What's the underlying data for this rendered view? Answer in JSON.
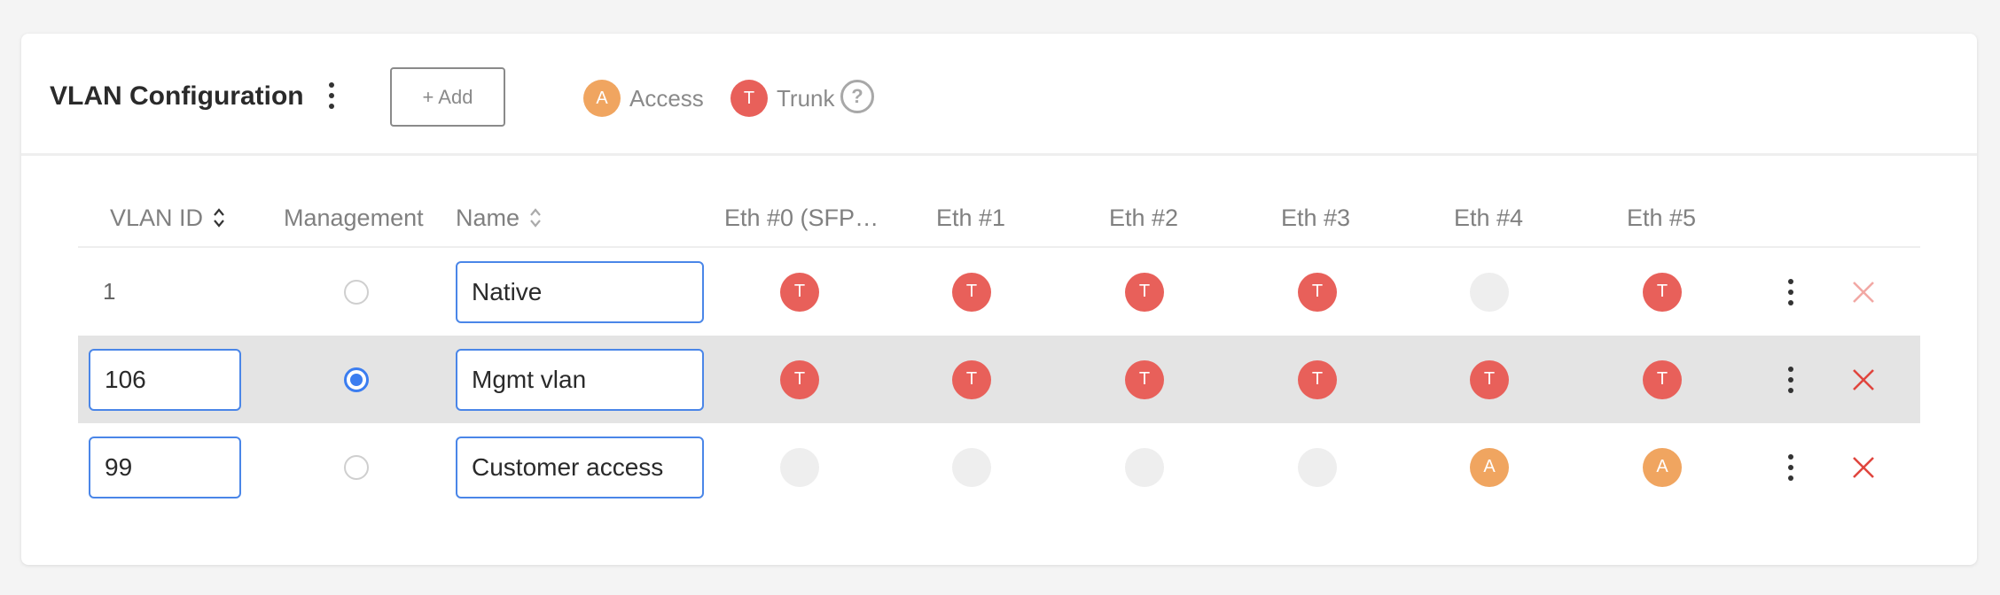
{
  "header": {
    "title": "VLAN Configuration",
    "add_label": "+ Add",
    "legend": [
      {
        "letter": "A",
        "label": "Access",
        "kind": "access"
      },
      {
        "letter": "T",
        "label": "Trunk",
        "kind": "trunk"
      }
    ],
    "help_glyph": "?"
  },
  "colors": {
    "trunk": "#e8605a",
    "access": "#f0a560",
    "empty_port": "#eeeeee",
    "accent": "#3b7df0",
    "input_border": "#4a86e8",
    "selected_row": "#e4e4e4"
  },
  "table": {
    "columns": {
      "vlan_id": "VLAN ID",
      "management": "Management",
      "name": "Name",
      "ports": [
        "Eth #0 (SFP…",
        "Eth #1",
        "Eth #2",
        "Eth #3",
        "Eth #4",
        "Eth #5"
      ]
    },
    "rows": [
      {
        "vlan_id": "1",
        "id_editable": false,
        "management": false,
        "name": "Native",
        "selected": false,
        "ports": [
          "T",
          "T",
          "T",
          "T",
          "",
          "T"
        ]
      },
      {
        "vlan_id": "106",
        "id_editable": true,
        "management": true,
        "name": "Mgmt vlan",
        "selected": true,
        "ports": [
          "T",
          "T",
          "T",
          "T",
          "T",
          "T"
        ]
      },
      {
        "vlan_id": "99",
        "id_editable": true,
        "management": false,
        "name": "Customer access",
        "selected": false,
        "ports": [
          "",
          "",
          "",
          "",
          "A",
          "A"
        ]
      }
    ]
  }
}
